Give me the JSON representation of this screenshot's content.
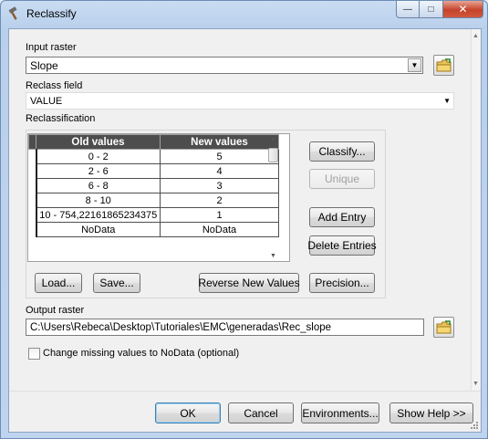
{
  "window": {
    "title": "Reclassify"
  },
  "input_raster": {
    "label": "Input raster",
    "value": "Slope"
  },
  "reclass_field": {
    "label": "Reclass field",
    "value": "VALUE"
  },
  "reclassification": {
    "label": "Reclassification",
    "columns": [
      "Old values",
      "New values"
    ],
    "rows": [
      {
        "old": "0 - 2",
        "new": "5"
      },
      {
        "old": "2 - 6",
        "new": "4"
      },
      {
        "old": "6 - 8",
        "new": "3"
      },
      {
        "old": "8 - 10",
        "new": "2"
      },
      {
        "old": "10 - 754,22161865234375",
        "new": "1"
      },
      {
        "old": "NoData",
        "new": "NoData"
      }
    ],
    "buttons": {
      "classify": "Classify...",
      "unique": "Unique",
      "add_entry": "Add Entry",
      "delete_entries": "Delete Entries",
      "load": "Load...",
      "save": "Save...",
      "reverse": "Reverse New Values",
      "precision": "Precision..."
    }
  },
  "output_raster": {
    "label": "Output raster",
    "value": "C:\\Users\\Rebeca\\Desktop\\Tutoriales\\EMC\\generadas\\Rec_slope"
  },
  "change_missing": {
    "label": "Change missing values to NoData (optional)",
    "checked": false
  },
  "footer": {
    "ok": "OK",
    "cancel": "Cancel",
    "environments": "Environments...",
    "show_help": "Show Help >>"
  },
  "caption": {
    "minimize": "—",
    "maximize": "□",
    "close": "✕"
  }
}
